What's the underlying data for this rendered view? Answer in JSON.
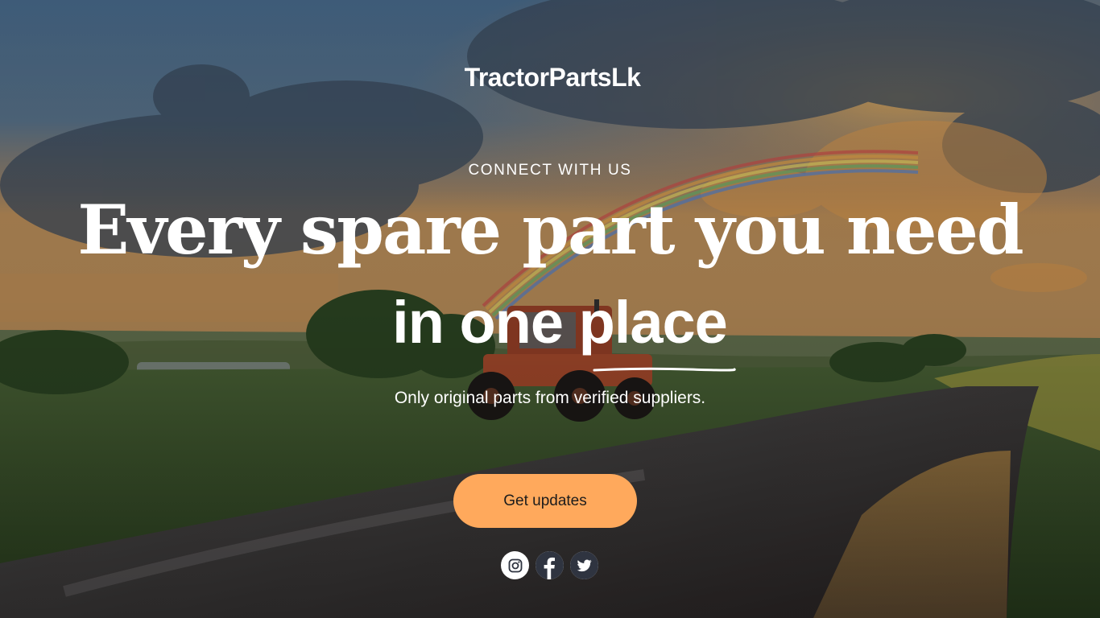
{
  "brand": {
    "name": "TractorPartsLk"
  },
  "hero": {
    "eyebrow": "CONNECT WITH US",
    "headline_line1": "Every spare part you need",
    "headline_line2": "in one place",
    "subtitle": "Only original parts from verified suppliers.",
    "cta_label": "Get updates"
  },
  "social": [
    {
      "icon": "instagram-icon"
    },
    {
      "icon": "facebook-icon"
    },
    {
      "icon": "twitter-icon"
    }
  ],
  "colors": {
    "accent": "#ffa95c",
    "text": "#ffffff",
    "button_text": "#1c1c1c",
    "icon_fg": "#2f3440"
  }
}
